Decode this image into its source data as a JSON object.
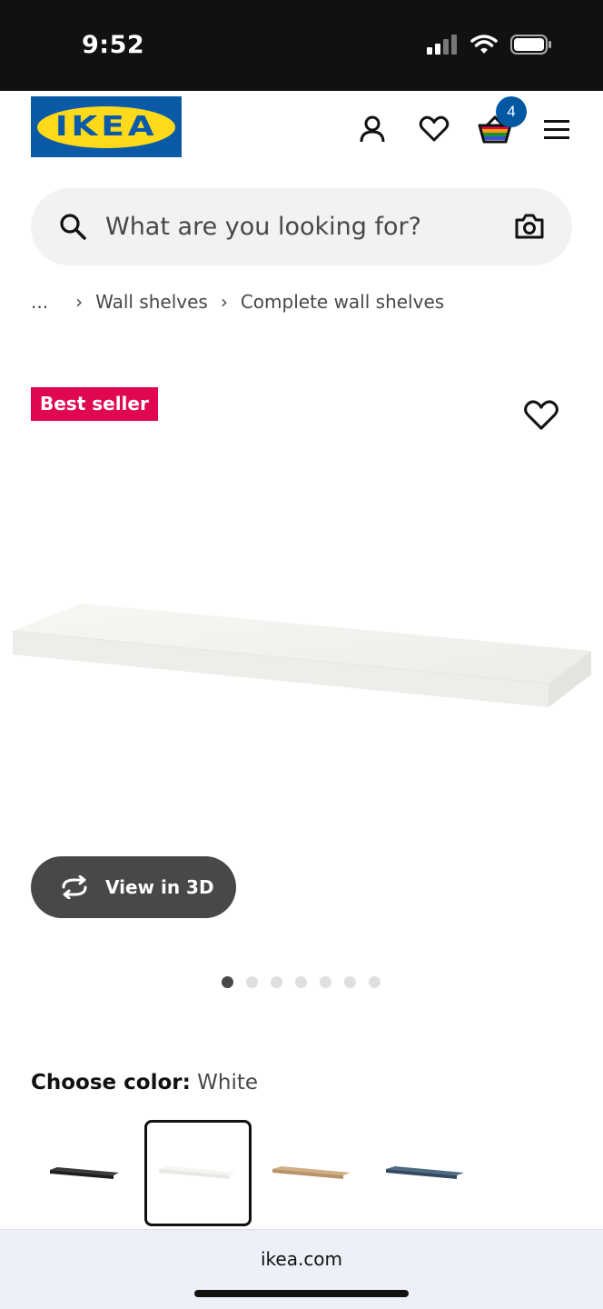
{
  "status_bar": {
    "time": "9:52"
  },
  "header": {
    "logo_text": "IKEA",
    "cart_count": "4"
  },
  "search": {
    "placeholder": "What are you looking for?"
  },
  "breadcrumb": {
    "ellipsis": "...",
    "items": [
      "Wall shelves",
      "Complete wall shelves"
    ]
  },
  "product": {
    "badge": "Best seller",
    "view3d_label": "View in 3D",
    "image_count": 7,
    "active_image": 1
  },
  "color": {
    "label": "Choose color:",
    "selected": "White",
    "swatches": [
      {
        "name": "black",
        "hex": "#2b2b2b"
      },
      {
        "name": "white",
        "hex": "#f2f2f2"
      },
      {
        "name": "oak",
        "hex": "#c9a57a"
      },
      {
        "name": "blue",
        "hex": "#3f5a73"
      }
    ]
  },
  "browser": {
    "url": "ikea.com"
  },
  "colors": {
    "brand_blue": "#0058a3",
    "brand_yellow": "#ffda1a",
    "badge_red": "#e00751"
  }
}
